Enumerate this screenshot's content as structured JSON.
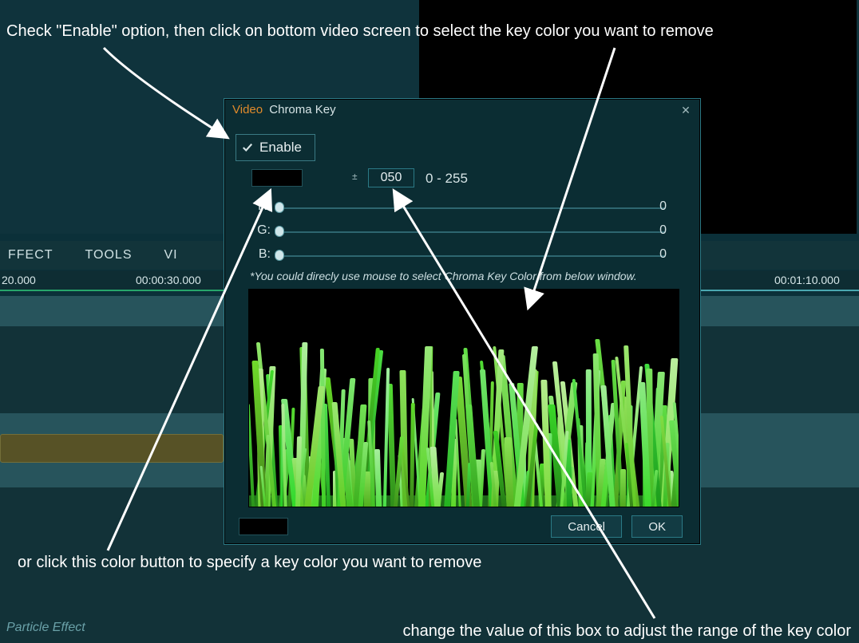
{
  "annotations": {
    "top": "Check \"Enable\" option, then click on bottom video screen to select the key color you want to remove",
    "mid": "or click this color button to specify a key color you want to remove",
    "bottom": "change the value of this box to adjust the range of the key color"
  },
  "menu": {
    "effect": "FFECT",
    "tools": "TOOLS",
    "view_partial": "VI"
  },
  "ruler": {
    "t0": "20.000",
    "t1": "00:00:30.000",
    "t2": "00:01:10.000"
  },
  "footer": {
    "clip_label": "Particle Effect"
  },
  "dialog": {
    "title_a": "Video",
    "title_b": "Chroma Key",
    "close_glyph": "✕",
    "enable_label": "Enable",
    "enable_checked": true,
    "color_swatch": "#000000",
    "tolerance_value": "050",
    "tolerance_prefix": "±",
    "tolerance_range": "0 - 255",
    "sliders": {
      "r": {
        "label": "R:",
        "value": "0"
      },
      "g": {
        "label": "G:",
        "value": "0"
      },
      "b": {
        "label": "B:",
        "value": "0"
      }
    },
    "hint": "*You could direcly use mouse to select Chroma Key Color from below window.",
    "picked_swatch": "#000000",
    "cancel": "Cancel",
    "ok": "OK"
  }
}
